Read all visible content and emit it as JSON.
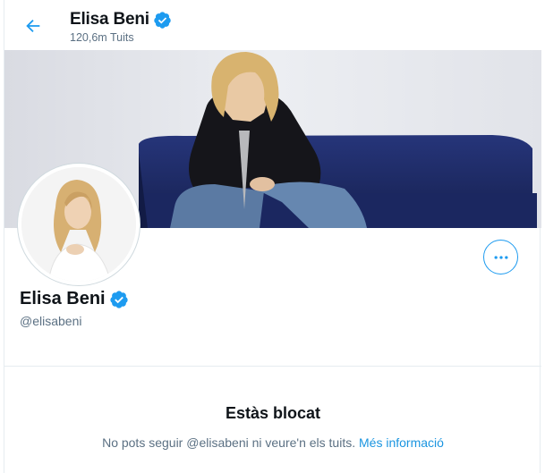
{
  "header": {
    "name": "Elisa Beni",
    "tweet_count": "120,6m Tuits"
  },
  "profile": {
    "name": "Elisa Beni",
    "handle": "@elisabeni",
    "verified": true
  },
  "blocked": {
    "title": "Estàs blocat",
    "message": "No pots seguir @elisabeni ni veure'n els tuits.",
    "link": "Més informació"
  },
  "colors": {
    "accent": "#1d9bf0",
    "verified": "#1d9bf0",
    "secondary_text": "#5b7083",
    "sofa": "#1f2c6b"
  },
  "icons": {
    "back": "back-arrow-icon",
    "verified": "verified-badge-icon",
    "more": "more-options-icon"
  }
}
